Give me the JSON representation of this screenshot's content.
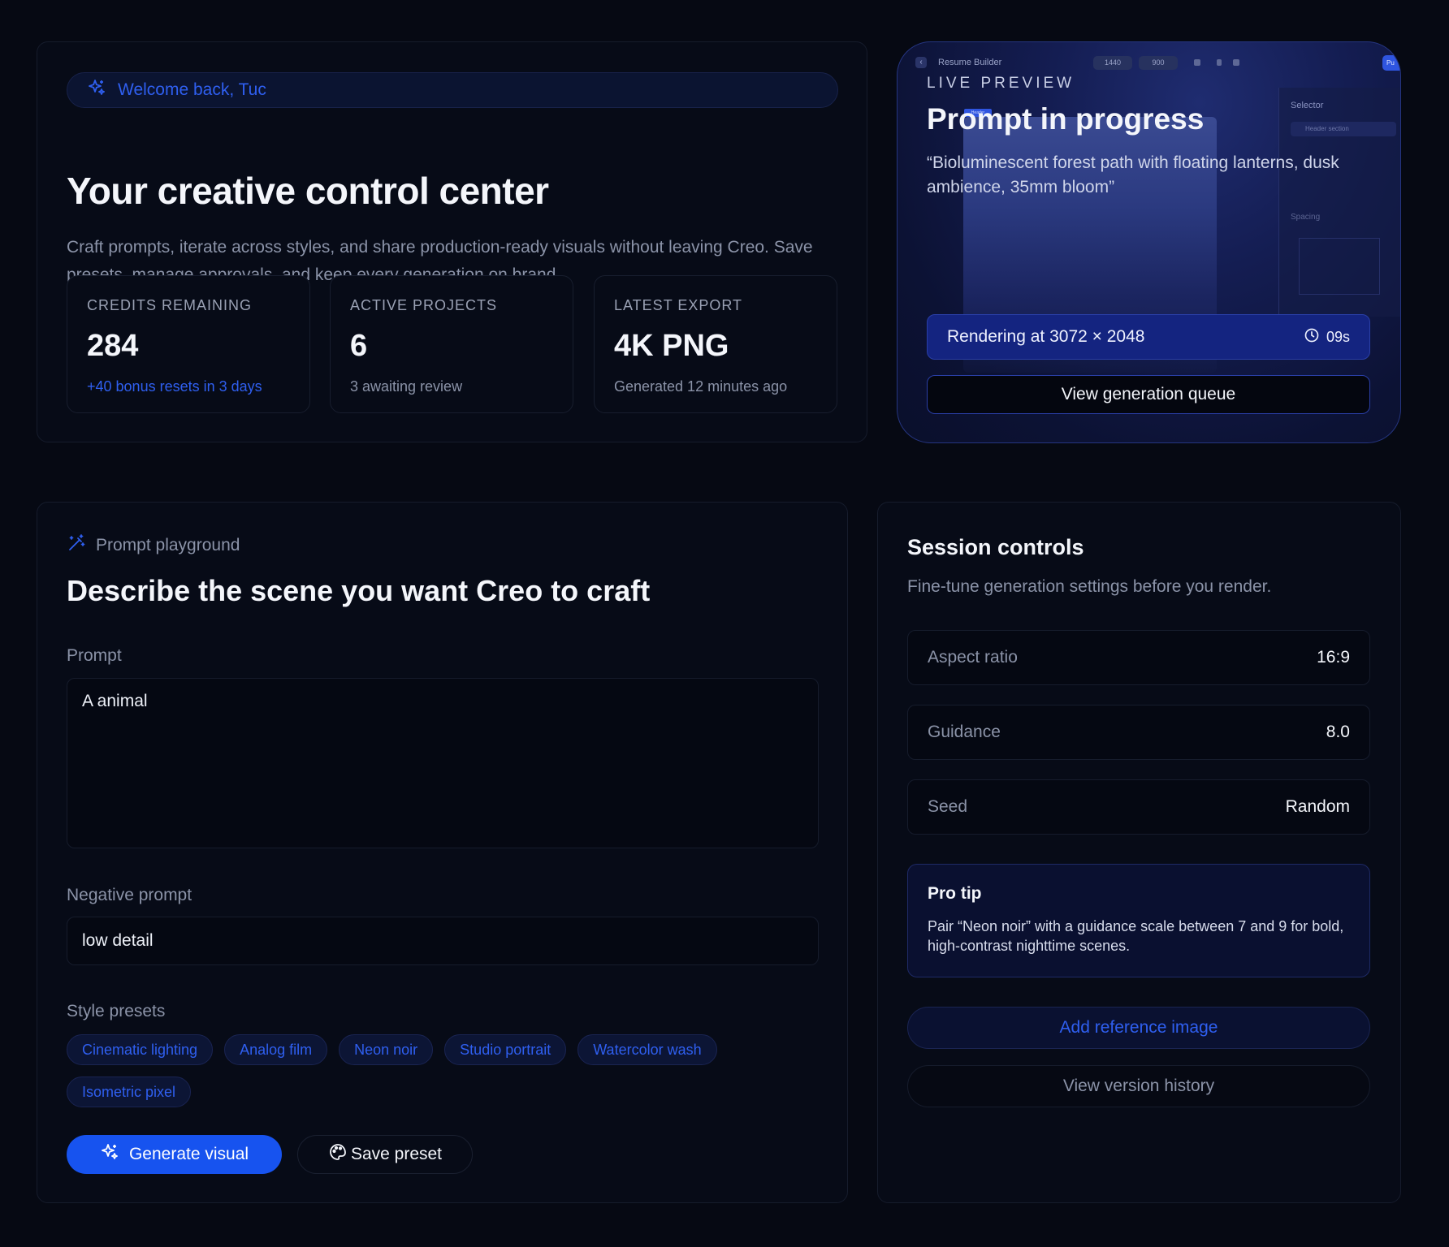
{
  "hero": {
    "welcome": "Welcome back, Tuc",
    "title": "Your creative control center",
    "description": "Craft prompts, iterate across styles, and share production-ready visuals without leaving Creo. Save presets, manage approvals, and keep every generation on brand.",
    "stats": [
      {
        "label": "CREDITS REMAINING",
        "value": "284",
        "sub": "+40 bonus resets in 3 days"
      },
      {
        "label": "ACTIVE PROJECTS",
        "value": "6",
        "sub": "3 awaiting review"
      },
      {
        "label": "LATEST EXPORT",
        "value": "4K PNG",
        "sub": "Generated 12 minutes ago"
      }
    ]
  },
  "preview": {
    "app_bar": {
      "name": "Resume Builder",
      "width": "1440",
      "height": "900",
      "publish": "Pu"
    },
    "panel": {
      "selector": "Selector",
      "row": "Header section",
      "spacing": "Spacing"
    },
    "ghost_tag": "Header",
    "eyebrow": "LIVE PREVIEW",
    "title": "Prompt in progress",
    "quote": "“Bioluminescent forest path with floating lanterns, dusk ambience, 35mm bloom”",
    "render_text": "Rendering at 3072 × 2048",
    "timer": "09s",
    "queue_button": "View generation queue"
  },
  "playground": {
    "eyebrow": "Prompt playground",
    "title": "Describe the scene you want Creo to craft",
    "prompt_label": "Prompt",
    "prompt_value": "A animal",
    "negative_label": "Negative prompt",
    "negative_value": "low detail",
    "presets_label": "Style presets",
    "presets": [
      "Cinematic lighting",
      "Analog film",
      "Neon noir",
      "Studio portrait",
      "Watercolor wash",
      "Isometric pixel"
    ],
    "generate_button": "Generate visual",
    "save_button": "Save preset"
  },
  "session": {
    "title": "Session controls",
    "description": "Fine-tune generation settings before you render.",
    "settings": [
      {
        "key": "Aspect ratio",
        "value": "16:9"
      },
      {
        "key": "Guidance",
        "value": "8.0"
      },
      {
        "key": "Seed",
        "value": "Random"
      }
    ],
    "tip_title": "Pro tip",
    "tip_body": "Pair “Neon noir” with a guidance scale between 7 and 9 for bold, high-contrast nighttime scenes.",
    "reference_button": "Add reference image",
    "history_button": "View version history"
  },
  "colors": {
    "accent": "#1753ef",
    "accent_text": "#2f5ff0",
    "background": "#060913"
  }
}
